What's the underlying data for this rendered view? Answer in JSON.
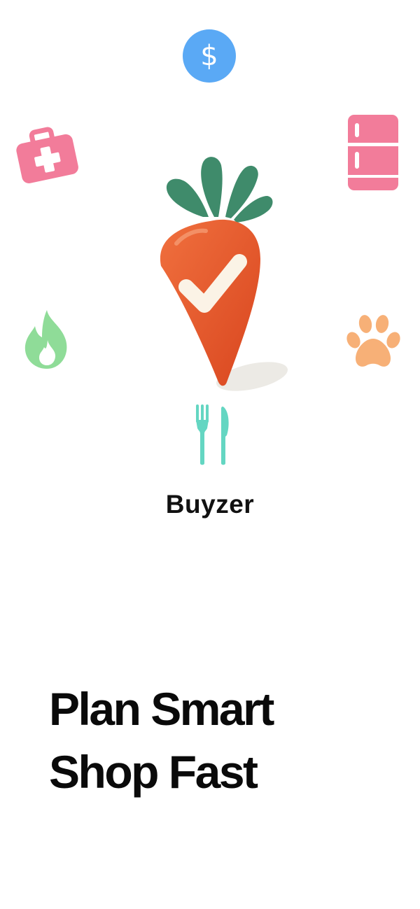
{
  "splash": {
    "brand_name": "Buyzer",
    "headline_line1": "Plan Smart",
    "headline_line2": "Shop Fast"
  },
  "logo": {
    "name": "carrot-check-icon",
    "colors": {
      "carrot": "#e8552b",
      "leaves": "#3f8b6b",
      "check": "#fbf3e6"
    }
  },
  "category_icons": [
    {
      "name": "dollar-icon",
      "color": "#5aa9f5"
    },
    {
      "name": "first-aid-kit-icon",
      "color": "#f27c9a"
    },
    {
      "name": "fridge-icon",
      "color": "#f27c9a"
    },
    {
      "name": "flame-icon",
      "color": "#8fdc98"
    },
    {
      "name": "paw-icon",
      "color": "#f7b077"
    },
    {
      "name": "fork-knife-icon",
      "color": "#64d6c2"
    }
  ]
}
